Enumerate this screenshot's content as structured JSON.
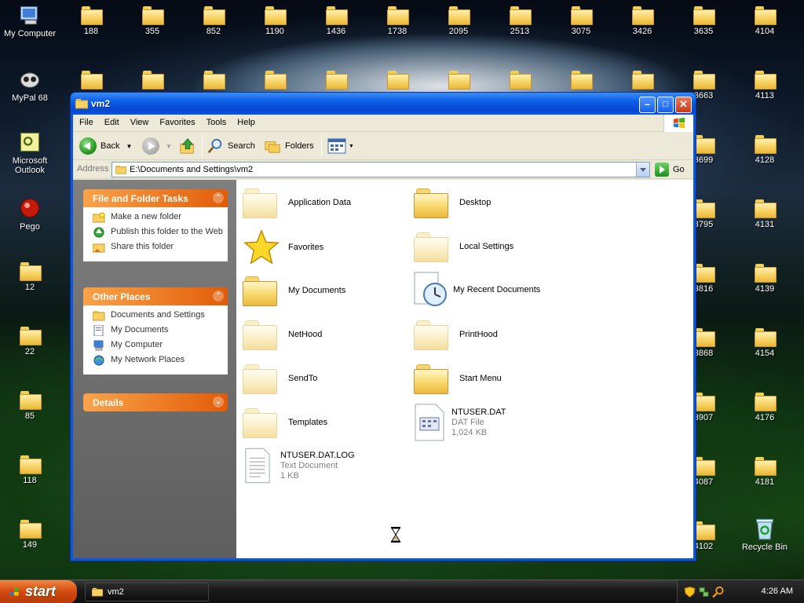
{
  "desktop": {
    "left_icons": [
      {
        "label": "My Computer",
        "icon": "my-computer-icon"
      },
      {
        "label": "MyPal 68",
        "icon": "mypal-icon"
      },
      {
        "label": "Microsoft Outlook",
        "icon": "outlook-icon"
      },
      {
        "label": "Pego",
        "icon": "pego-icon"
      },
      {
        "label": "12",
        "icon": "folder-icon"
      },
      {
        "label": "22",
        "icon": "folder-icon"
      },
      {
        "label": "85",
        "icon": "folder-icon"
      },
      {
        "label": "118",
        "icon": "folder-icon"
      },
      {
        "label": "149",
        "icon": "folder-icon"
      }
    ],
    "top_row_folders": [
      "188",
      "355",
      "852",
      "1190",
      "1436",
      "1738",
      "2095",
      "2513",
      "3075",
      "3426",
      "3635",
      "4104"
    ],
    "right_col_a": [
      "3663",
      "3699",
      "3795",
      "3816",
      "3868",
      "3907",
      "4087",
      "4102"
    ],
    "right_col_b": [
      "4113",
      "4128",
      "4131",
      "4139",
      "4154",
      "4176",
      "4181"
    ],
    "recycle_bin": "Recycle Bin"
  },
  "window": {
    "title": "vm2",
    "menu": [
      "File",
      "Edit",
      "View",
      "Favorites",
      "Tools",
      "Help"
    ],
    "toolbar": {
      "back": "Back",
      "search": "Search",
      "folders": "Folders"
    },
    "address": {
      "label": "Address",
      "value": "E:\\Documents and Settings\\vm2",
      "go": "Go"
    },
    "tasks": {
      "file_folder_title": "File and Folder Tasks",
      "file_folder_items": [
        "Make a new folder",
        "Publish this folder to the Web",
        "Share this folder"
      ],
      "other_places_title": "Other Places",
      "other_places_items": [
        "Documents and Settings",
        "My Documents",
        "My Computer",
        "My Network Places"
      ],
      "details_title": "Details"
    },
    "files": [
      {
        "name": "Application Data",
        "kind": "folder-faded"
      },
      {
        "name": "Desktop",
        "kind": "folder"
      },
      {
        "name": "Favorites",
        "kind": "star"
      },
      {
        "name": "Local Settings",
        "kind": "folder-faded"
      },
      {
        "name": "My Documents",
        "kind": "folder"
      },
      {
        "name": "My Recent Documents",
        "kind": "recent"
      },
      {
        "name": "NetHood",
        "kind": "folder-faded"
      },
      {
        "name": "PrintHood",
        "kind": "folder-faded"
      },
      {
        "name": "SendTo",
        "kind": "folder-faded"
      },
      {
        "name": "Start Menu",
        "kind": "folder"
      },
      {
        "name": "Templates",
        "kind": "folder-faded"
      },
      {
        "name": "NTUSER.DAT",
        "kind": "dat",
        "type": "DAT File",
        "size": "1,024 KB"
      },
      {
        "name": "NTUSER.DAT.LOG",
        "kind": "txt",
        "type": "Text Document",
        "size": "1 KB"
      }
    ]
  },
  "taskbar": {
    "start": "start",
    "task_item": "vm2",
    "clock": "4:26 AM"
  }
}
